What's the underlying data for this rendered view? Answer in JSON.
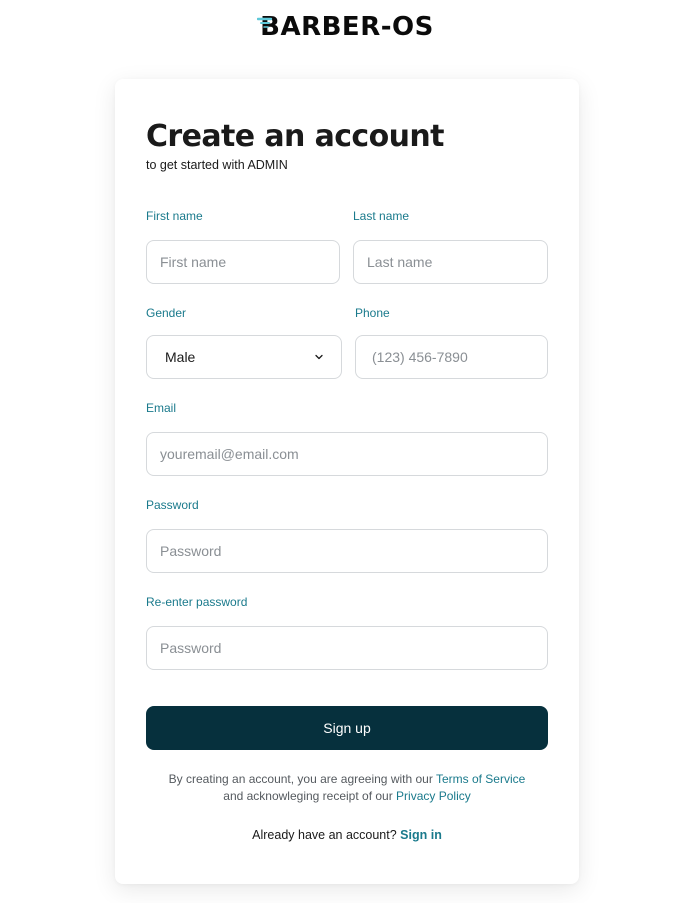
{
  "brand": {
    "name": "BARBER-OS",
    "accent": "#5fc9d9"
  },
  "header": {
    "title": "Create an account",
    "subtitle": "to get started with ADMIN"
  },
  "form": {
    "first_name": {
      "label": "First name",
      "placeholder": "First name",
      "value": ""
    },
    "last_name": {
      "label": "Last name",
      "placeholder": "Last name",
      "value": ""
    },
    "gender": {
      "label": "Gender",
      "selected": "Male",
      "icon": "chevron-down-icon"
    },
    "phone": {
      "label": "Phone",
      "placeholder": "(123) 456-7890",
      "value": ""
    },
    "email": {
      "label": "Email",
      "placeholder": "youremail@email.com",
      "value": ""
    },
    "password": {
      "label": "Password",
      "placeholder": "Password",
      "value": ""
    },
    "confirm_password": {
      "label": "Re-enter password",
      "placeholder": "Password",
      "value": ""
    },
    "submit_label": "Sign up"
  },
  "legal": {
    "line1_prefix": "By creating an account, you are agreeing with our ",
    "terms_link": "Terms of Service",
    "line2_prefix": "and acknowleging receipt of our ",
    "privacy_link": "Privacy Policy"
  },
  "signin": {
    "prompt": "Already have an account? ",
    "link": "Sign in"
  },
  "colors": {
    "primary_button": "#06303d",
    "label": "#1a7a8c",
    "link": "#1a7a8c",
    "border": "#d6d9dc"
  }
}
